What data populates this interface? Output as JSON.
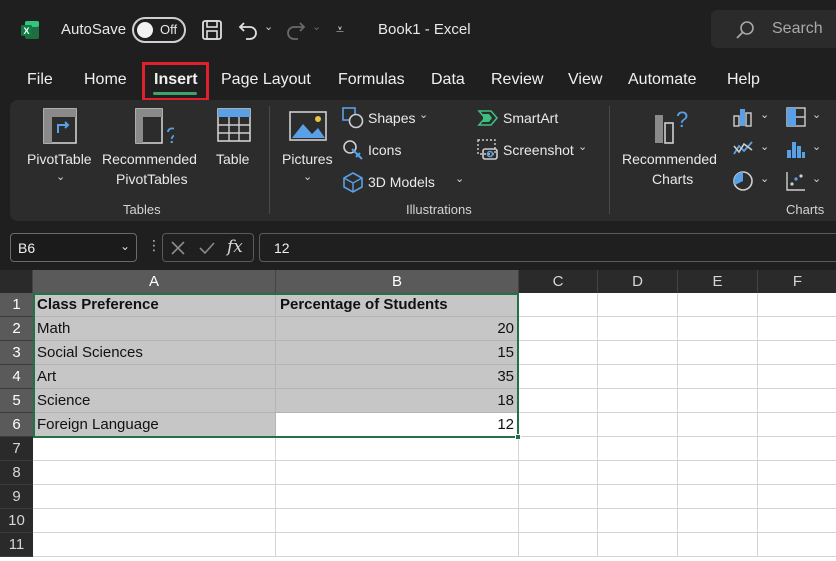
{
  "titlebar": {
    "autosave_label": "AutoSave",
    "autosave_state": "Off",
    "doc_title": "Book1  -  Excel",
    "search_placeholder": "Search"
  },
  "tabs": [
    "File",
    "Home",
    "Insert",
    "Page Layout",
    "Formulas",
    "Data",
    "Review",
    "View",
    "Automate",
    "Help"
  ],
  "active_tab": "Insert",
  "ribbon": {
    "tables": {
      "group_label": "Tables",
      "pivottable": "PivotTable",
      "recommended_1": "Recommended",
      "recommended_2": "PivotTables",
      "table": "Table"
    },
    "illustrations": {
      "group_label": "Illustrations",
      "pictures": "Pictures",
      "shapes": "Shapes",
      "icons": "Icons",
      "models3d": "3D Models",
      "smartart": "SmartArt",
      "screenshot": "Screenshot"
    },
    "charts": {
      "group_label": "Charts",
      "recommended_1": "Recommended",
      "recommended_2": "Charts"
    }
  },
  "formula_bar": {
    "name_box": "B6",
    "formula": "12"
  },
  "columns": [
    "A",
    "B",
    "C",
    "D",
    "E",
    "F"
  ],
  "rows": [
    "1",
    "2",
    "3",
    "4",
    "5",
    "6",
    "7",
    "8",
    "9",
    "10",
    "11"
  ],
  "sheet": {
    "header": [
      "Class Preference",
      "Percentage of Students"
    ],
    "data": [
      [
        "Math",
        "20"
      ],
      [
        "Social Sciences",
        "15"
      ],
      [
        "Art",
        "35"
      ],
      [
        "Science",
        "18"
      ],
      [
        "Foreign Language",
        "12"
      ]
    ]
  },
  "colors": {
    "accent_green": "#217346",
    "highlight_red": "#e0202c",
    "selection_gray": "#c6c6c6"
  }
}
